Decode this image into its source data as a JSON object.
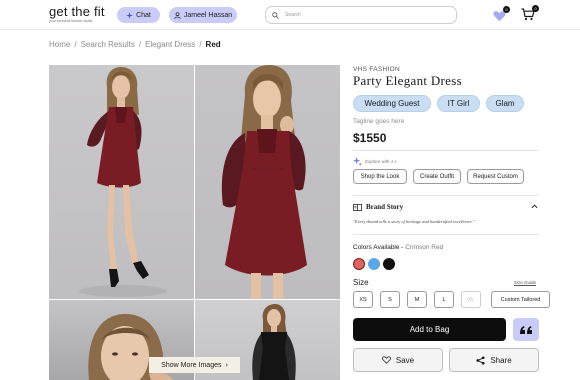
{
  "header": {
    "logo": "get the fit",
    "logo_tagline": "your personal fashion stylist",
    "chat_label": "Chat",
    "user_label": "Jameel Hassan",
    "search_placeholder": "Search",
    "wishlist_count": "0",
    "cart_count": "0"
  },
  "breadcrumb": {
    "items": [
      "Home",
      "Search Results",
      "Elegant Dress"
    ],
    "separator": "/",
    "current": "Red"
  },
  "gallery": {
    "show_more_label": "Show More Images",
    "show_more_arrow": "›"
  },
  "product": {
    "brand": "VHS FASHION",
    "title": "Party Elegant Dress",
    "tags": [
      "Wedding Guest",
      "IT Girl",
      "Glam"
    ],
    "tagline": "Tagline goes here",
    "price": "$1550",
    "explore_label": "Explore with A.I.",
    "ai_buttons": [
      "Shop the Look",
      "Create Outfit",
      "Request Custom"
    ],
    "brand_story_title": "Brand Story",
    "brand_story_text": "\"Every thread tells a story of heritage and handcrafted excellence.\"",
    "colors_label": "Colors Available - ",
    "selected_color": "Crimson Red",
    "colors": [
      "#e06262",
      "#5aa6e8",
      "#111111"
    ],
    "size_label": "Size",
    "size_guide": "Size Guide",
    "sizes": [
      "XS",
      "S",
      "M",
      "L",
      "XL"
    ],
    "custom_size": "Custom Tailored",
    "add_to_bag": "Add to Bag",
    "save_label": "Save",
    "share_label": "Share"
  },
  "colors": {
    "accent": "#c9ccf6",
    "tag_bg": "#c9def3",
    "dress": "#7a1c24"
  }
}
